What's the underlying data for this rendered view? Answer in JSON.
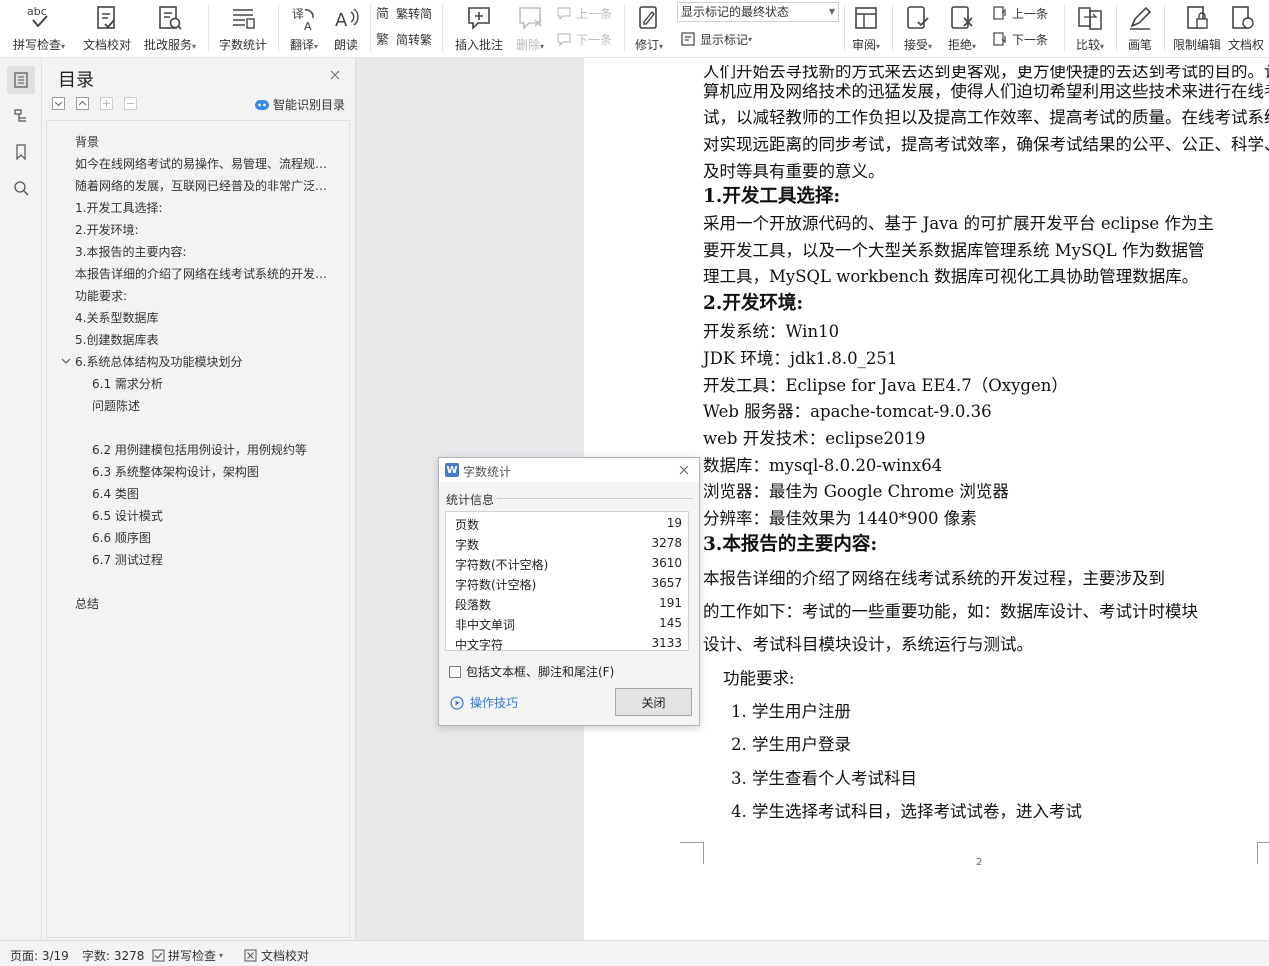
{
  "ribbon": {
    "spellcheck": "拼写检查",
    "doc_proof": "文档校对",
    "review_service": "批改服务",
    "word_count": "字数统计",
    "translate": "翻译",
    "read_aloud": "朗读",
    "trad_to_simp": "繁转简",
    "simp_to_trad": "简转繁",
    "insert_comment": "插入批注",
    "delete": "删除",
    "prev_comment": "上一条",
    "next_comment": "下一条",
    "track_changes": "修订",
    "markup_state": "显示标记的最终状态",
    "show_markup": "显示标记",
    "review_pane": "审阅",
    "accept": "接受",
    "reject": "拒绝",
    "prev_change": "上一条",
    "next_change": "下一条",
    "compare": "比较",
    "ink": "画笔",
    "restrict_edit": "限制编辑",
    "doc_rights": "文档权"
  },
  "toc": {
    "title": "目录",
    "smart_detect": "智能识别目录",
    "items": [
      "背景",
      "如今在线网络考试的易操作、易管理、流程规范化等特点使得在线考试越来越普遍",
      "随着网络的发展，互联网已经普及的非常广泛，很多考试都采用网络考试",
      "1.开发工具选择:",
      "2.开发环境:",
      "3.本报告的主要内容:",
      "本报告详细的介绍了网络在线考试系统的开发过程，主要涉及到的工作如下",
      "功能要求:",
      "4.关系型数据库",
      "5.创建数据库表",
      "6.系统总体结构及功能模块划分",
      "6.1 需求分析",
      "问题陈述",
      "6.2 用例建模包括用例设计，用例规约等",
      "6.3 系统整体架构设计，架构图",
      "6.4 类图",
      "6.5 设计模式",
      "6.6 顺序图",
      "6.7 测试过程",
      "总结"
    ]
  },
  "document": {
    "para1": [
      "人们开始去寻找新的方式来去达到更客观，更方便快捷的去达到考试的目的。计",
      "算机应用及网络技术的迅猛发展，使得人们迫切希望利用这些技术来进行在线考",
      "试，以减轻教师的工作负担以及提高工作效率、提高考试的质量。在线考试系统",
      "对实现远距离的同步考试，提高考试效率，确保考试结果的公平、公正、科学、",
      "及时等具有重要的意义。"
    ],
    "h1": "1.开发工具选择:",
    "para2": [
      "  采用一个开放源代码的、基于 Java 的可扩展开发平台 eclipse 作为主",
      "要开发工具，以及一个大型关系数据库管理系统 MySQL  作为数据管",
      "理工具，MySQL workbench 数据库可视化工具协助管理数据库。"
    ],
    "h2": "2.开发环境:",
    "env": [
      "开发系统：Win10",
      "JDK 环境：jdk1.8.0_251",
      "开发工具：Eclipse for Java EE4.7（Oxygen）",
      "Web 服务器：apache-tomcat-9.0.36",
      "web 开发技术：eclipse2019",
      "数据库：mysql-8.0.20-winx64",
      "浏览器：最佳为 Google Chrome 浏览器",
      "分辨率：最佳效果为 1440*900 像素"
    ],
    "h3": "3.本报告的主要内容:",
    "para3": [
      "      本报告详细的介绍了网络在线考试系统的开发过程，主要涉及到",
      "的工作如下：考试的一些重要功能，如：数据库设计、考试计时模块",
      "设计、考试科目模块设计，系统运行与测试。"
    ],
    "func_label": "功能要求:",
    "list": [
      "1.   学生用户注册",
      "2.   学生用户登录",
      "3.   学生查看个人考试科目",
      "4.   学生选择考试科目，选择考试试卷，进入考试"
    ],
    "page_number": "2"
  },
  "dialog": {
    "title": "字数统计",
    "section": "统计信息",
    "stats": [
      {
        "label": "页数",
        "value": "19"
      },
      {
        "label": "字数",
        "value": "3278"
      },
      {
        "label": "字符数(不计空格)",
        "value": "3610"
      },
      {
        "label": "字符数(计空格)",
        "value": "3657"
      },
      {
        "label": "段落数",
        "value": "191"
      },
      {
        "label": "非中文单词",
        "value": "145"
      },
      {
        "label": "中文字符",
        "value": "3133"
      }
    ],
    "include_label": "包括文本框、脚注和尾注(F)",
    "tips": "操作技巧",
    "close": "关闭"
  },
  "status": {
    "page": "页面: 3/19",
    "words": "字数: 3278",
    "spellcheck": "拼写检查",
    "proof": "文档校对"
  }
}
